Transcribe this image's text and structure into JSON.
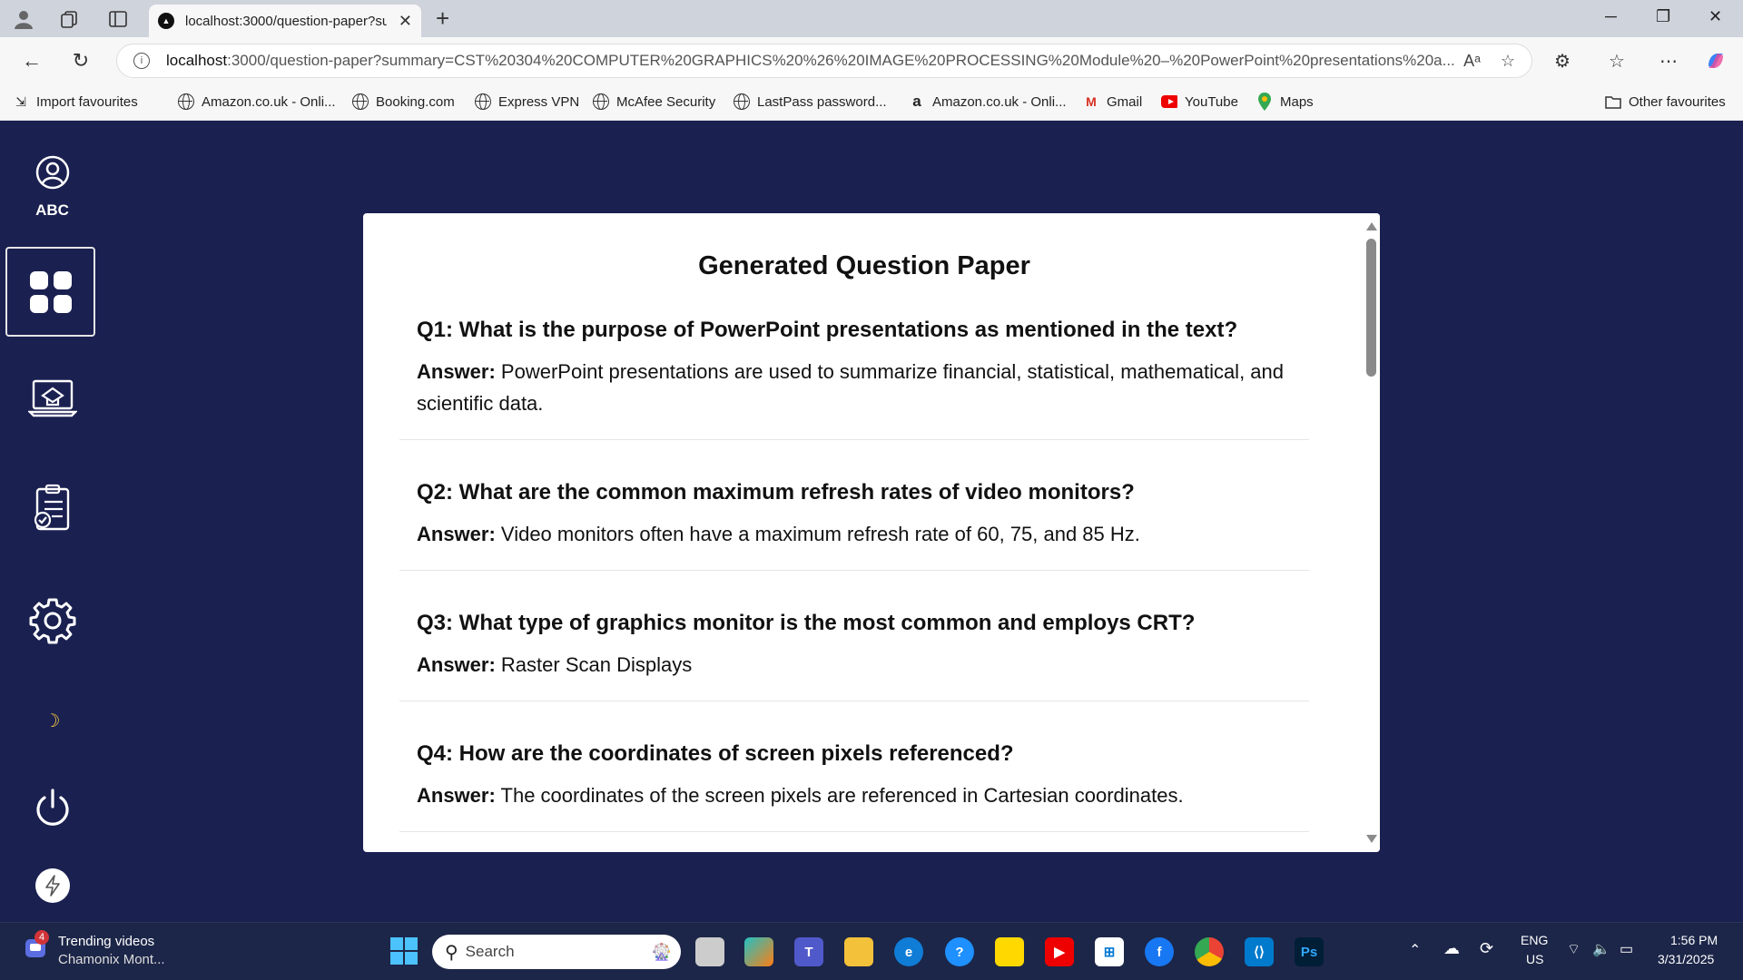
{
  "browser": {
    "tab_title": "localhost:3000/question-paper?su",
    "url_host": "localhost",
    "url_rest": ":3000/question-paper?summary=CST%20304%20COMPUTER%20GRAPHICS%20%26%20IMAGE%20PROCESSING%20Module%20–%20PowerPoint%20presentations%20a...",
    "favourites": [
      {
        "label": "Import favourites",
        "icon": "import-icon"
      },
      {
        "label": "Amazon.co.uk - Onli...",
        "icon": "globe-icon"
      },
      {
        "label": "Booking.com",
        "icon": "globe-icon"
      },
      {
        "label": "Express VPN",
        "icon": "globe-icon"
      },
      {
        "label": "McAfee Security",
        "icon": "globe-icon"
      },
      {
        "label": "LastPass password...",
        "icon": "globe-icon"
      },
      {
        "label": "Amazon.co.uk - Onli...",
        "icon": "amazon-icon"
      },
      {
        "label": "Gmail",
        "icon": "gmail-icon"
      },
      {
        "label": "YouTube",
        "icon": "youtube-icon"
      },
      {
        "label": "Maps",
        "icon": "maps-icon"
      }
    ],
    "other_favourites": "Other favourites"
  },
  "sidebar": {
    "user_label": "ABC",
    "items": [
      {
        "name": "dashboard",
        "icon": "dashboard-icon",
        "active": true
      },
      {
        "name": "exam",
        "icon": "exam-icon"
      },
      {
        "name": "checklist",
        "icon": "checklist-icon"
      },
      {
        "name": "settings",
        "icon": "gear-icon"
      },
      {
        "name": "theme",
        "icon": "moon-icon"
      },
      {
        "name": "logout",
        "icon": "power-icon"
      }
    ]
  },
  "paper": {
    "title": "Generated Question Paper",
    "answer_label": "Answer:",
    "questions": [
      {
        "q": "Q1: What is the purpose of PowerPoint presentations as mentioned in the text?",
        "a": "PowerPoint presentations are used to summarize financial, statistical, mathematical, and scientific data."
      },
      {
        "q": "Q2: What are the common maximum refresh rates of video monitors?",
        "a": "Video monitors often have a maximum refresh rate of 60, 75, and 85 Hz."
      },
      {
        "q": "Q3: What type of graphics monitor is the most common and employs CRT?",
        "a": "Raster Scan Displays"
      },
      {
        "q": "Q4: How are the coordinates of screen pixels referenced?",
        "a": "The coordinates of the screen pixels are referenced in Cartesian coordinates."
      }
    ]
  },
  "taskbar": {
    "widget_badge": "4",
    "widget_title": "Trending videos",
    "widget_sub": "Chamonix Mont...",
    "search_placeholder": "Search",
    "lang": "ENG",
    "region": "US",
    "time": "1:56 PM",
    "date": "3/31/2025"
  },
  "colors": {
    "app_bg": "#1a2050",
    "panel_bg": "#ffffff",
    "taskbar_bg": "#1c2648"
  }
}
